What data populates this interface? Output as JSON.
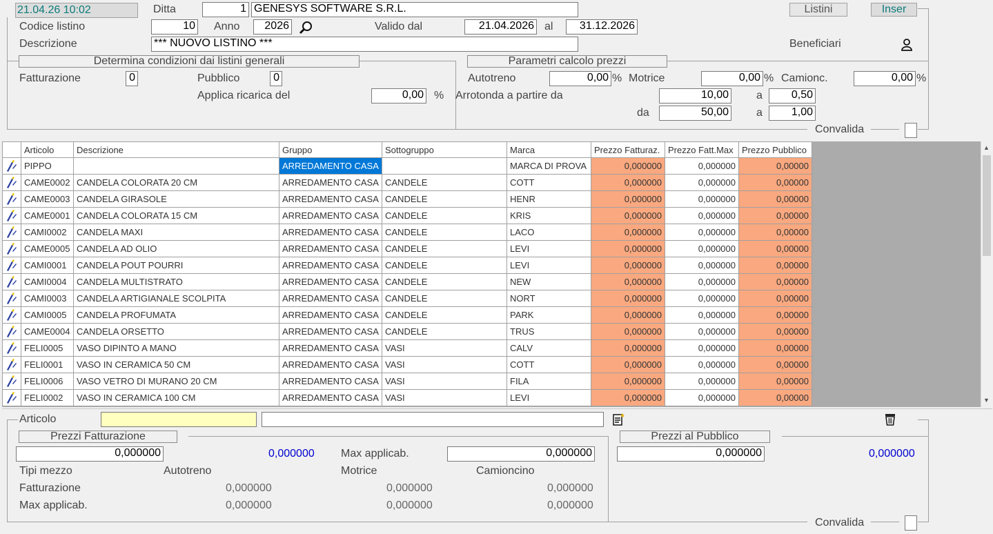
{
  "header": {
    "datetime": "21.04.26 10:02",
    "ditta_label": "Ditta",
    "ditta_code": "1",
    "ditta_name": "GENESYS SOFTWARE S.R.L.",
    "listini_btn": "Listini",
    "inser_btn": "Inser",
    "codice_label": "Codice  listino",
    "codice_value": "10",
    "anno_label": "Anno",
    "anno_value": "2026",
    "valido_label": "Valido dal",
    "valido_dal": "21.04.2026",
    "al_label": "al",
    "valido_al": "31.12.2026",
    "descrizione_label": "Descrizione",
    "descrizione_value": "*** NUOVO LISTINO ***",
    "beneficiari_label": "Beneficiari"
  },
  "condizioni": {
    "title": "Determina condizioni dai listini generali",
    "fatturazione_label": "Fatturazione",
    "fatturazione_value": "0",
    "pubblico_label": "Pubblico",
    "pubblico_value": "0",
    "ricarica_label": "Applica ricarica del",
    "ricarica_value": "0,00",
    "pct": "%"
  },
  "parametri": {
    "title": "Parametri calcolo prezzi",
    "autotreno_label": "Autotreno",
    "autotreno_value": "0,00",
    "motrice_label": "Motrice",
    "motrice_value": "0,00",
    "camionc_label": "Camionc.",
    "camionc_value": "0,00",
    "pct": "%",
    "arrotonda_label": "Arrotonda a partire da",
    "da_label": "da",
    "a_label": "a",
    "r1_from": "10,00",
    "r1_to": "0,50",
    "r2_from": "50,00",
    "r2_to": "1,00",
    "convalida_label": "Convalida"
  },
  "grid": {
    "columns": [
      "Articolo",
      "Descrizione",
      "Gruppo",
      "Sottogruppo",
      "Marca",
      "Prezzo Fatturaz.",
      "Prezzo Fatt.Max",
      "Prezzo Pubblico"
    ],
    "rows": [
      [
        "PIPPO",
        "",
        "ARREDAMENTO CASA",
        "",
        "MARCA DI PROVA",
        "0,000000",
        "0,000000",
        "0,00000"
      ],
      [
        "CAME0002",
        "CANDELA COLORATA 20 CM",
        "ARREDAMENTO CASA",
        "CANDELE",
        "COTT",
        "0,000000",
        "0,000000",
        "0,00000"
      ],
      [
        "CAME0003",
        "CANDELA GIRASOLE",
        "ARREDAMENTO CASA",
        "CANDELE",
        "HENR",
        "0,000000",
        "0,000000",
        "0,00000"
      ],
      [
        "CAME0001",
        "CANDELA COLORATA 15 CM",
        "ARREDAMENTO CASA",
        "CANDELE",
        "KRIS",
        "0,000000",
        "0,000000",
        "0,00000"
      ],
      [
        "CAMI0002",
        "CANDELA MAXI",
        "ARREDAMENTO CASA",
        "CANDELE",
        "LACO",
        "0,000000",
        "0,000000",
        "0,00000"
      ],
      [
        "CAME0005",
        "CANDELA AD OLIO",
        "ARREDAMENTO CASA",
        "CANDELE",
        "LEVI",
        "0,000000",
        "0,000000",
        "0,00000"
      ],
      [
        "CAMI0001",
        "CANDELA POUT POURRI",
        "ARREDAMENTO CASA",
        "CANDELE",
        "LEVI",
        "0,000000",
        "0,000000",
        "0,00000"
      ],
      [
        "CAMI0004",
        "CANDELA MULTISTRATO",
        "ARREDAMENTO CASA",
        "CANDELE",
        "NEW",
        "0,000000",
        "0,000000",
        "0,00000"
      ],
      [
        "CAMI0003",
        "CANDELA ARTIGIANALE SCOLPITA",
        "ARREDAMENTO CASA",
        "CANDELE",
        "NORT",
        "0,000000",
        "0,000000",
        "0,00000"
      ],
      [
        "CAMI0005",
        "CANDELA PROFUMATA",
        "ARREDAMENTO CASA",
        "CANDELE",
        "PARK",
        "0,000000",
        "0,000000",
        "0,00000"
      ],
      [
        "CAME0004",
        "CANDELA ORSETTO",
        "ARREDAMENTO CASA",
        "CANDELE",
        "TRUS",
        "0,000000",
        "0,000000",
        "0,00000"
      ],
      [
        "FELI0005",
        "VASO DIPINTO A MANO",
        "ARREDAMENTO CASA",
        "VASI",
        "CALV",
        "0,000000",
        "0,000000",
        "0,00000"
      ],
      [
        "FELI0001",
        "VASO IN CERAMICA 50 CM",
        "ARREDAMENTO CASA",
        "VASI",
        "COTT",
        "0,000000",
        "0,000000",
        "0,00000"
      ],
      [
        "FELI0006",
        "VASO VETRO DI MURANO 20 CM",
        "ARREDAMENTO CASA",
        "VASI",
        "FILA",
        "0,000000",
        "0,000000",
        "0,00000"
      ],
      [
        "FELI0002",
        "VASO IN CERAMICA 100 CM",
        "ARREDAMENTO CASA",
        "VASI",
        "LEVI",
        "0,000000",
        "0,000000",
        "0,00000"
      ]
    ]
  },
  "detail": {
    "articolo_label": "Articolo",
    "articolo_code": "",
    "articolo_desc": "",
    "prezzi_fatt_title": "Prezzi Fatturazione",
    "prezzi_pub_title": "Prezzi al Pubblico",
    "fatt_value": "0,000000",
    "fatt_blue": "0,000000",
    "max_label": "Max applicab.",
    "max_value": "0,000000",
    "pub_value": "0,000000",
    "pub_blue": "0,000000",
    "tipi_label": "Tipi mezzo",
    "autotreno_label": "Autotreno",
    "motrice_label": "Motrice",
    "camioncino_label": "Camioncino",
    "fatturazione_label": "Fatturazione",
    "maxapp_label": "Max applicab.",
    "fatt_auto": "0,000000",
    "fatt_motr": "0,000000",
    "fatt_cam": "0,000000",
    "max_auto": "0,000000",
    "max_motr": "0,000000",
    "max_cam": "0,000000",
    "convalida_label": "Convalida"
  }
}
